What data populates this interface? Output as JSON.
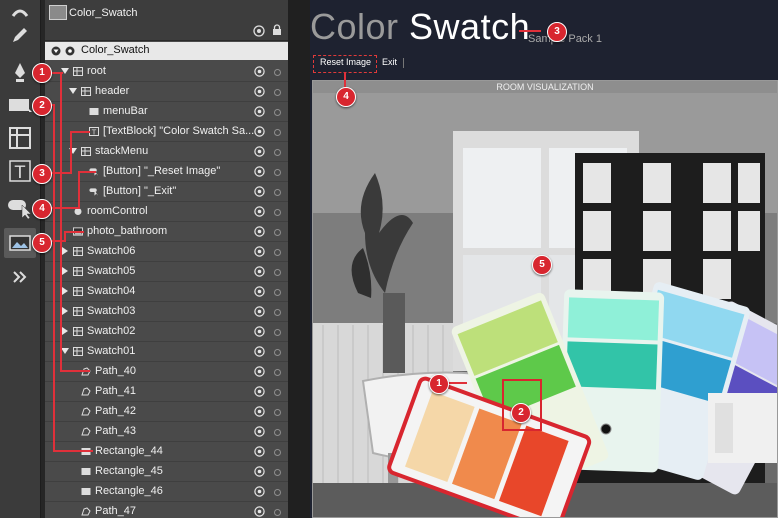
{
  "panel": {
    "document_name": "Color_Swatch",
    "object_header": "Color_Swatch",
    "rows": [
      {
        "label": "root",
        "type": "grid",
        "expanded": true
      },
      {
        "label": "header",
        "type": "grid",
        "expanded": true
      },
      {
        "label": "menuBar",
        "type": "rect",
        "expanded": null
      },
      {
        "label": "[TextBlock] \"Color Swatch Sa...",
        "type": "text",
        "expanded": null
      },
      {
        "label": "stackMenu",
        "type": "grid",
        "expanded": true
      },
      {
        "label": "[Button] \"_Reset Image\"",
        "type": "button",
        "expanded": null
      },
      {
        "label": "[Button] \"_Exit\"",
        "type": "button",
        "expanded": null
      },
      {
        "label": "roomControl",
        "type": "control",
        "expanded": null
      },
      {
        "label": "photo_bathroom",
        "type": "image",
        "expanded": null
      },
      {
        "label": "Swatch06",
        "type": "grid",
        "expanded": false
      },
      {
        "label": "Swatch05",
        "type": "grid",
        "expanded": false
      },
      {
        "label": "Swatch04",
        "type": "grid",
        "expanded": false
      },
      {
        "label": "Swatch03",
        "type": "grid",
        "expanded": false
      },
      {
        "label": "Swatch02",
        "type": "grid",
        "expanded": false
      },
      {
        "label": "Swatch01",
        "type": "grid",
        "expanded": true
      },
      {
        "label": "Path_40",
        "type": "path",
        "expanded": null
      },
      {
        "label": "Path_41",
        "type": "path",
        "expanded": null
      },
      {
        "label": "Path_42",
        "type": "path",
        "expanded": null
      },
      {
        "label": "Path_43",
        "type": "path",
        "expanded": null
      },
      {
        "label": "Rectangle_44",
        "type": "rect",
        "expanded": null
      },
      {
        "label": "Rectangle_45",
        "type": "rect",
        "expanded": null
      },
      {
        "label": "Rectangle_46",
        "type": "rect",
        "expanded": null
      },
      {
        "label": "Path_47",
        "type": "path",
        "expanded": null
      }
    ]
  },
  "stage": {
    "title_light": "Color",
    "title_bold": "Swatch",
    "subtitle": "Sample Pack 1",
    "reset_label": "Reset Image",
    "exit_label": "Exit",
    "room_header": "ROOM VISUALIZATION"
  },
  "callouts": {
    "left": [
      "1",
      "2",
      "3",
      "4",
      "5"
    ],
    "stage": [
      "3",
      "4",
      "5",
      "1",
      "2"
    ]
  },
  "swatch_colors": [
    "#f5d7a8",
    "#f08a4c",
    "#e8472a",
    "#bde07a",
    "#5ec94a",
    "#8ff0d8",
    "#32c4a8",
    "#90d8f0",
    "#2f9fd0",
    "#c6c2f5",
    "#5b4fc0",
    "#e0e0e0"
  ],
  "accent_color": "#d8262f"
}
